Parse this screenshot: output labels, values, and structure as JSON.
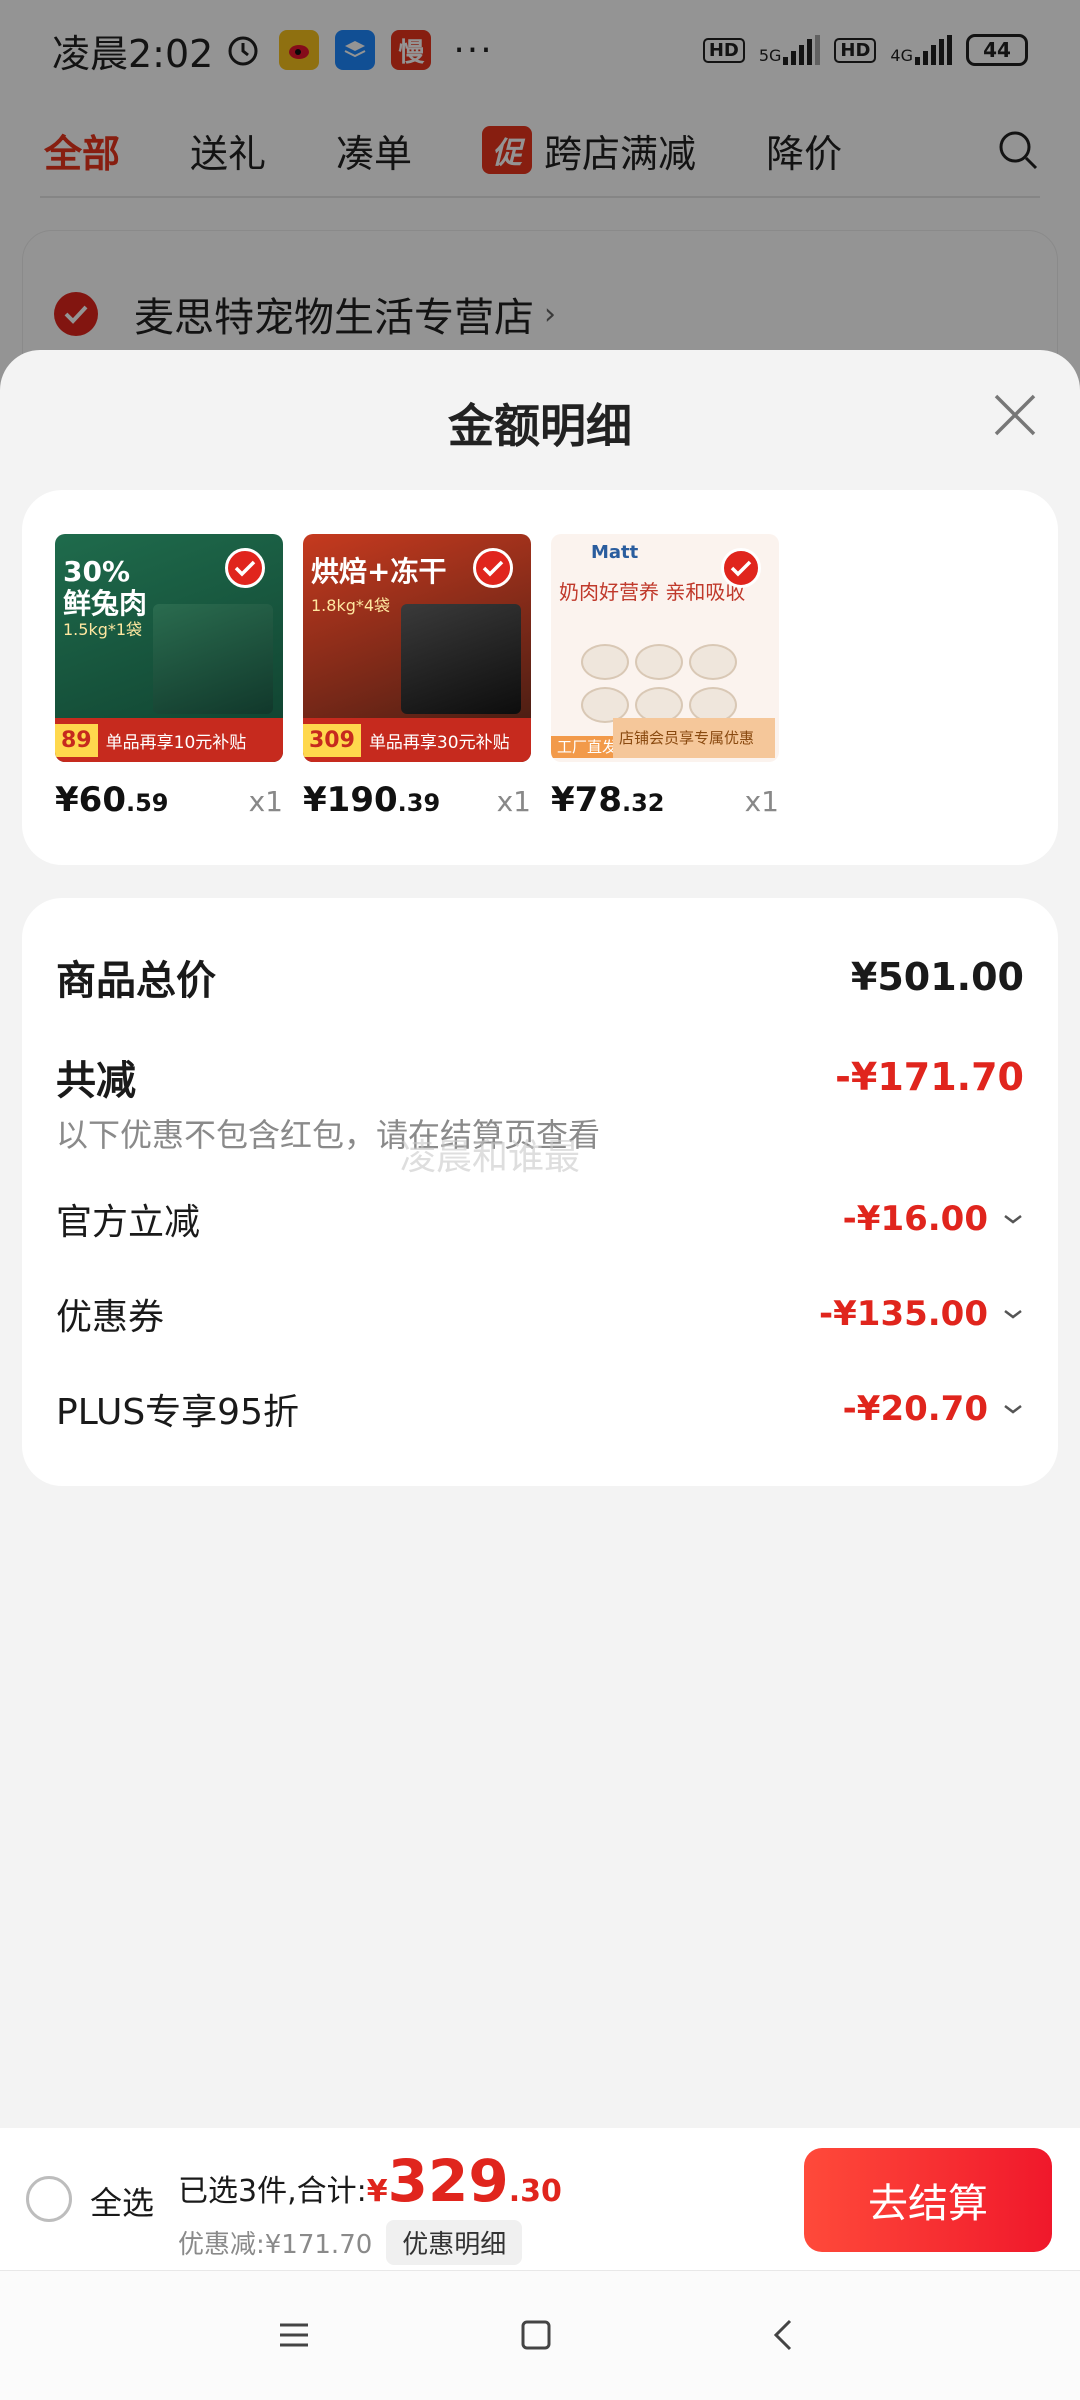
{
  "status_bar": {
    "time": "凌晨2:02",
    "more": "···",
    "battery": "44",
    "net1": "5G",
    "net2": "4G",
    "hd": "HD"
  },
  "top_tabs": {
    "items": [
      "全部",
      "送礼",
      "凑单"
    ],
    "promo_badge": "促",
    "promo_label": "跨店满减",
    "last": "降价"
  },
  "store": {
    "name": "麦思特宠物生活专营店"
  },
  "sheet": {
    "title": "金额明细"
  },
  "goods": [
    {
      "price_int": "¥60",
      "price_dec": ".59",
      "qty": "x1",
      "img_title1": "30%",
      "img_title2": "鲜兔肉",
      "img_sub": "1.5kg*1袋",
      "img_tag": "89",
      "img_bar": "单品再享10元补贴"
    },
    {
      "price_int": "¥190",
      "price_dec": ".39",
      "qty": "x1",
      "img_title1": "烘焙+冻干",
      "img_title2": "",
      "img_sub": "1.8kg*4袋",
      "img_tag": "309",
      "img_bar": "单品再享30元补贴"
    },
    {
      "price_int": "¥78",
      "price_dec": ".32",
      "qty": "x1",
      "img_title1": "奶肉好营养 亲和吸收",
      "img_title2": "",
      "img_sub": "Matt",
      "img_tag": "工厂直发",
      "img_bar": "店铺会员享专属优惠"
    }
  ],
  "summary": {
    "total_label": "商品总价",
    "total_value": "¥501.00",
    "reduce_label": "共减",
    "reduce_value": "-¥171.70",
    "note": "以下优惠不包含红包，请在结算页查看",
    "discounts": [
      {
        "label": "官方立减",
        "value": "-¥16.00"
      },
      {
        "label": "优惠券",
        "value": "-¥135.00"
      },
      {
        "label": "PLUS专享95折",
        "value": "-¥20.70"
      }
    ]
  },
  "watermark": "凌晨和谁最",
  "bottom_bar": {
    "select_all": "全选",
    "selected_text": "已选3件,合计:",
    "currency": "¥",
    "total_int": "329",
    "total_dec": ".30",
    "discount_text": "优惠减:¥171.70",
    "detail_chip": "优惠明细",
    "checkout": "去结算"
  },
  "colors": {
    "accent_red": "#e0251d",
    "checkout_gradient_start": "#ff4a3a",
    "checkout_gradient_end": "#f0182b"
  }
}
